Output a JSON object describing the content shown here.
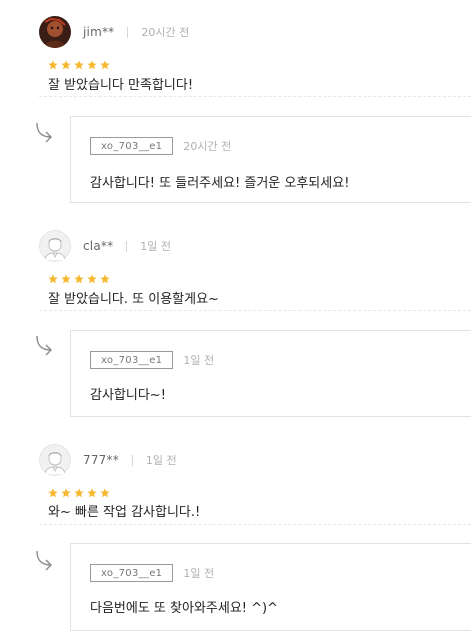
{
  "reviews": [
    {
      "username": "jim**",
      "time": "20시간 전",
      "rating": 5,
      "text": "잘 받았습니다 만족합니다!",
      "avatar": "photo-avatar",
      "reply": {
        "seller": "xo_703__e1",
        "time": "20시간 전",
        "text": "감사합니다! 또 들러주세요! 즐거운 오후되세요!"
      }
    },
    {
      "username": "cla**",
      "time": "1일 전",
      "rating": 5,
      "text": "잘 받았습니다. 또 이용할게요~",
      "avatar": "default-avatar",
      "reply": {
        "seller": "xo_703__e1",
        "time": "1일 전",
        "text": "감사합니다~!"
      }
    },
    {
      "username": "777**",
      "time": "1일 전",
      "rating": 5,
      "text": "와~ 빠른 작업 감사합니다.!",
      "avatar": "default-avatar",
      "reply": {
        "seller": "xo_703__e1",
        "time": "1일 전",
        "text": "다음번에도 또 찾아와주세요! ^)^"
      }
    }
  ],
  "colors": {
    "star": "#f5b82e",
    "border": "#e2e2e2",
    "muted": "#b0b0b0"
  },
  "icons": {
    "reply": "reply-arrow-icon",
    "star": "star-icon"
  }
}
